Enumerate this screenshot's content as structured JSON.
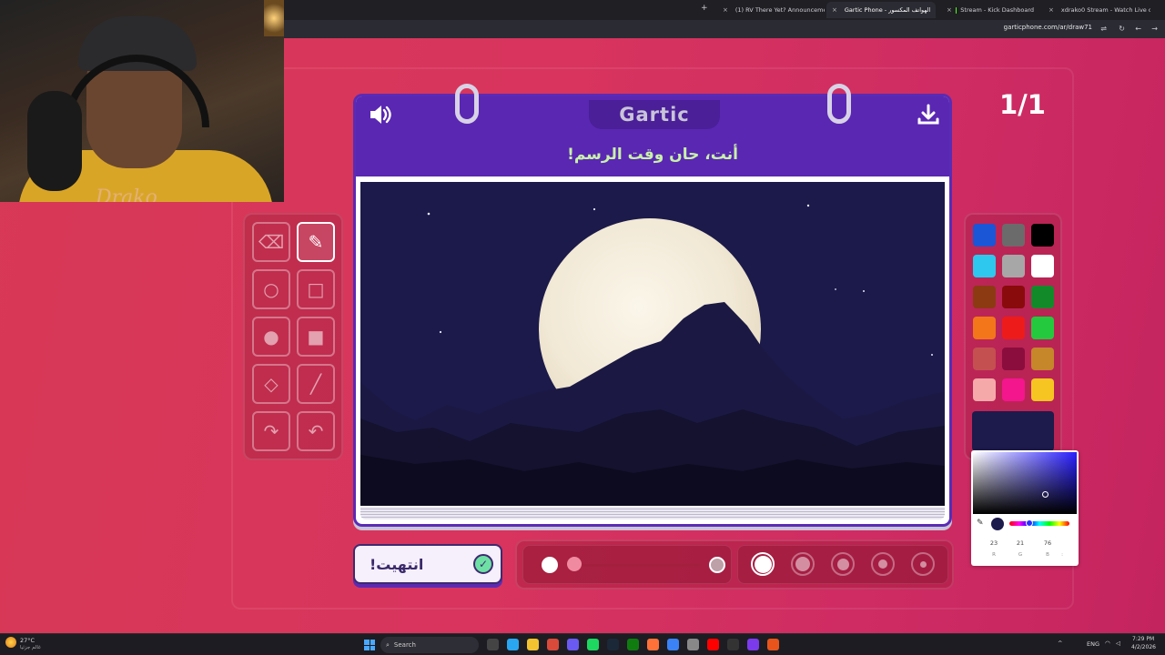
{
  "browser": {
    "tabs": [
      {
        "label": "(1) RV There Yet? Announceme",
        "active": false,
        "favicon_color": "#e23b3b"
      },
      {
        "label": "Gartic Phone - الهواتف المكسور",
        "active": true,
        "favicon_color": "#8d5cf5"
      },
      {
        "label": "Stream - Kick Dashboard",
        "active": false,
        "favicon_color": "#53fc18"
      },
      {
        "label": "xdrako0 Stream - Watch Live o",
        "active": false,
        "favicon_color": "#53fc18"
      }
    ],
    "new_tab": "+",
    "address": "garticphone.com/ar/draw71"
  },
  "game": {
    "brand": "Gartic",
    "prompt": "أنت، حان وقت الرسم!",
    "counter": "1/1",
    "sound_icon": "speaker-icon",
    "download_icon": "download-icon",
    "done_label": "انتهيت!",
    "tools": [
      {
        "name": "pen",
        "glyph": "✎",
        "active": true
      },
      {
        "name": "eraser",
        "glyph": "⌫",
        "active": false
      },
      {
        "name": "rectangle",
        "glyph": "□",
        "active": false
      },
      {
        "name": "ellipse",
        "glyph": "○",
        "active": false
      },
      {
        "name": "filled-rectangle",
        "glyph": "■",
        "active": false
      },
      {
        "name": "filled-ellipse",
        "glyph": "●",
        "active": false
      },
      {
        "name": "line",
        "glyph": "╱",
        "active": false
      },
      {
        "name": "fill-bucket",
        "glyph": "◇",
        "active": false
      },
      {
        "name": "undo",
        "glyph": "↶",
        "active": false
      },
      {
        "name": "redo",
        "glyph": "↷",
        "active": false
      }
    ],
    "palette": [
      "#1a56d6",
      "#6b6b6b",
      "#000000",
      "#2ec8ef",
      "#a7a7a7",
      "#ffffff",
      "#8c3a12",
      "#8a0b0b",
      "#138a2a",
      "#f4761b",
      "#ee1b1b",
      "#25c93d",
      "#c45050",
      "#8a0d3d",
      "#c6862a",
      "#f5a9a9",
      "#f4168d",
      "#f6c521"
    ],
    "current_color": "#1d1a4c",
    "color_picker": {
      "r": "23",
      "g": "21",
      "b": "76",
      "r_label": "R",
      "g_label": "G",
      "b_label": "B",
      "extra_label": ":"
    },
    "opacity_fraction": 0.0,
    "brush_sizes": [
      5,
      4,
      3,
      2,
      1
    ],
    "active_size": 0
  },
  "webcam": {
    "signature": "Drako"
  },
  "taskbar": {
    "weather": "27°C",
    "weather_sub": "غالم جزئيا",
    "search_label": "Search",
    "lang": "ENG",
    "time": "7:29 PM",
    "date": "4/2/2026"
  }
}
